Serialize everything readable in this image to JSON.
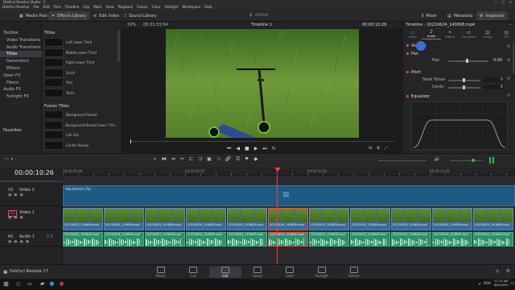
{
  "window": {
    "title": "DaVinci Resolve Studio - 2"
  },
  "menu": [
    "DaVinci Resolve",
    "File",
    "Edit",
    "Trim",
    "Timeline",
    "Clip",
    "Mark",
    "View",
    "Playback",
    "Fusion",
    "Color",
    "Fairlight",
    "Workspace",
    "Help"
  ],
  "toolbar": {
    "media_pool": "Media Pool",
    "effects_library": "Effects Library",
    "edit_index": "Edit Index",
    "sound_library": "Sound Library",
    "project_num": "2",
    "project_status": "Edited",
    "mixer": "Mixer",
    "metadata": "Metadata",
    "inspector": "Inspector"
  },
  "left_panel": {
    "items": [
      "Toolbox",
      "Video Transitions",
      "Audio Transitions",
      "Titles",
      "Generators",
      "Effects",
      "Open FX",
      "Filters",
      "Audio FX",
      "Fairlight FX"
    ],
    "favorites": "Favorites"
  },
  "effects": {
    "section1": "Titles",
    "titles": [
      "Left Lower Third",
      "Middle Lower Third",
      "Right Lower Third",
      "Scroll",
      "Text",
      "Text+"
    ],
    "section2": "Fusion Titles",
    "fusion_titles": [
      "Background Reveal",
      "Background Reveal Lower Third",
      "Call Out",
      "Center Reveal"
    ]
  },
  "viewer": {
    "zoom": "19%",
    "duration": "00:31:53:54",
    "timeline_name": "Timeline 1",
    "timecode": "00:00:10:26"
  },
  "inspector": {
    "clip_name": "Timeline - 20210624_143608.mp4",
    "tabs": [
      "Video",
      "Audio",
      "Effects",
      "Transition",
      "Image",
      "File"
    ],
    "active_tab": "Audio",
    "volume_label": "Volume",
    "pan_section": "Pan",
    "pan_label": "Pan",
    "pan_value": "0.00",
    "pitch_section": "Pitch",
    "semitones_label": "Semi Tones",
    "semitones_value": "0",
    "cents_label": "Cents",
    "cents_value": "0",
    "eq_section": "Equalizer"
  },
  "timeline": {
    "timecode": "00:00:10:26",
    "ruler": [
      "00:00:00:00",
      "00:00:05:00",
      "00:00:10:00",
      "00:00:15:00"
    ],
    "tracks": [
      {
        "id": "V2",
        "name": "Video 2"
      },
      {
        "id": "V1",
        "name": "Video 1"
      },
      {
        "id": "A1",
        "name": "Audio 1",
        "channels": "2.0"
      }
    ],
    "adjustment_clip": "Adjustment Clip",
    "clip_name": "20210624_143608.mp4"
  },
  "pages": [
    "Media",
    "Cut",
    "Edit",
    "Fusion",
    "Color",
    "Fairlight",
    "Deliver"
  ],
  "active_page": "Edit",
  "app_name": "DaVinci Resolve 17",
  "taskbar": {
    "lang": "ROU",
    "time": "11:12 AM",
    "date": "6/24/2021"
  },
  "colors": {
    "accent": "#e0524a",
    "video_track": "#3b6b9a",
    "audio_track": "#2f8f6a",
    "adjustment": "#1f5a82",
    "playhead": "#ff3b3b"
  }
}
